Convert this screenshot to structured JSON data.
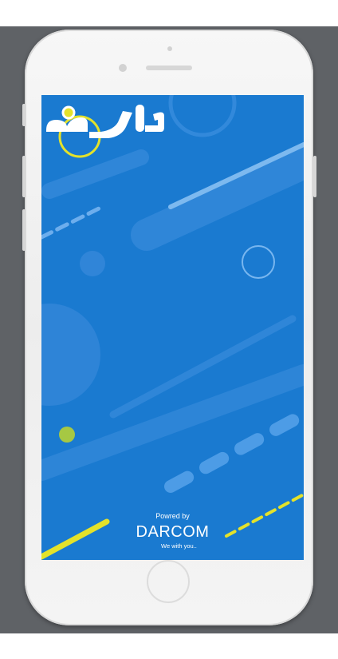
{
  "splash": {
    "app_logo_text": "داركم",
    "powered_by": "Powred by",
    "brand": "DARCOM",
    "tagline": "We with you.."
  },
  "colors": {
    "screen_bg": "#1a7ad0",
    "accent_yellow": "#e4e22a",
    "shape_light": "#3b8ee0"
  },
  "icons": {
    "logo_dot": "yellow-ring-dot"
  }
}
